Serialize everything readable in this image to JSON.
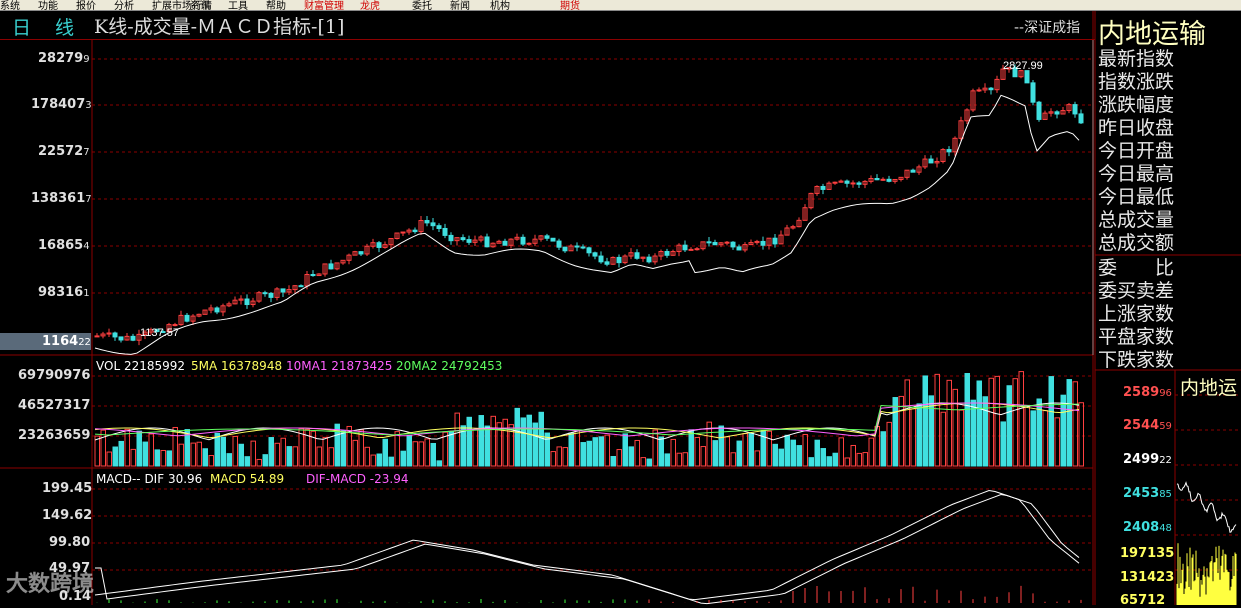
{
  "menu": {
    "items": [
      {
        "label": "系统",
        "red": false
      },
      {
        "label": "功能",
        "red": false
      },
      {
        "label": "报价",
        "red": false
      },
      {
        "label": "分析",
        "red": false
      },
      {
        "label": "扩展市场行情",
        "red": false
      },
      {
        "label": "资讯",
        "red": false
      },
      {
        "label": "工具",
        "red": false
      },
      {
        "label": "帮助",
        "red": false
      },
      {
        "label": "财富管理",
        "red": true
      },
      {
        "label": "龙虎",
        "red": true
      },
      {
        "label": "委托",
        "red": false
      },
      {
        "label": "新闻",
        "red": false
      },
      {
        "label": "机构",
        "red": false
      },
      {
        "label": "期货",
        "red": true
      }
    ]
  },
  "header": {
    "period_1": "日",
    "period_2": "线",
    "title": "K线-成交量-ＭＡＣＤ指标-[1]",
    "index_name": "--深证成指"
  },
  "price_panel": {
    "axis_labels": [
      {
        "main": "28279",
        "sub": "9"
      },
      {
        "main": "178407",
        "sub": "3"
      },
      {
        "main": "22572",
        "sub": "7"
      },
      {
        "main": "138361",
        "sub": "7"
      },
      {
        "main": "16865",
        "sub": "4"
      },
      {
        "main": "98316",
        "sub": "1"
      }
    ],
    "bottom_label": {
      "main": "1164",
      "sub": "22"
    },
    "high_marker": "2827.99",
    "low_marker": "1137.57"
  },
  "volume_panel": {
    "axis_labels": [
      "69790976",
      "46527317",
      "23263659"
    ],
    "legend": [
      {
        "text": "VOL 22185992",
        "color": "#ffffff"
      },
      {
        "text": "5MA 16378948",
        "color": "#ffff60"
      },
      {
        "text": "10MA1 21873425",
        "color": "#ff60ff"
      },
      {
        "text": "20MA2 24792453",
        "color": "#60ff60"
      }
    ]
  },
  "macd_panel": {
    "axis_labels": [
      "199.45",
      "149.62",
      "99.80",
      "49.97",
      "0.14"
    ],
    "legend": [
      {
        "text": "MACD-- DIF 30.96",
        "color": "#ffffff"
      },
      {
        "text": "MACD 54.89",
        "color": "#ffff60"
      },
      {
        "text": "DIF-MACD -23.94",
        "color": "#ff60ff"
      }
    ]
  },
  "info_panel": {
    "title": "内地运输",
    "labels": [
      "最新指数",
      "指数涨跌",
      "涨跌幅度",
      "昨日收盘",
      "今日开盘",
      "今日最高",
      "今日最低",
      "总成交量",
      "总成交额",
      "委　　比",
      "委买卖差",
      "上涨家数",
      "平盘家数",
      "下跌家数"
    ],
    "mini_title": "内地运",
    "mini_price_labels": [
      {
        "main": "2589",
        "sub": "96",
        "color": "#ff5050"
      },
      {
        "main": "2544",
        "sub": "59",
        "color": "#ff5050"
      },
      {
        "main": "2499",
        "sub": "22",
        "color": "#ffffff"
      },
      {
        "main": "2453",
        "sub": "85",
        "color": "#40e0e0"
      },
      {
        "main": "2408",
        "sub": "48",
        "color": "#40e0e0"
      }
    ],
    "mini_vol_labels": [
      "197135",
      "131423",
      "65712"
    ]
  },
  "watermark": "大数跨境",
  "colors": {
    "up": "#ff4040",
    "down": "#40e0e0",
    "grid": "#8b0000",
    "text": "#e0e0e0"
  }
}
